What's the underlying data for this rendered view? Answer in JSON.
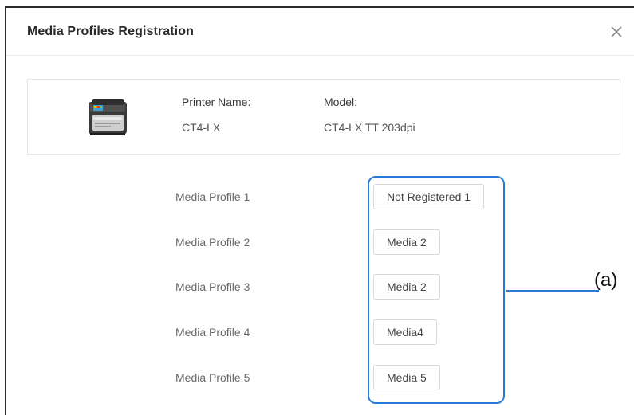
{
  "dialog": {
    "title": "Media Profiles Registration",
    "close_icon": "close-icon"
  },
  "printer": {
    "image_icon": "printer-icon",
    "name_label": "Printer Name:",
    "name_value": "CT4-LX",
    "model_label": "Model:",
    "model_value": "CT4-LX TT 203dpi"
  },
  "profiles": [
    {
      "label": "Media Profile 1",
      "value": "Not Registered 1"
    },
    {
      "label": "Media Profile 2",
      "value": "Media 2"
    },
    {
      "label": "Media Profile 3",
      "value": "Media 2"
    },
    {
      "label": "Media Profile 4",
      "value": "Media4"
    },
    {
      "label": "Media Profile 5",
      "value": "Media 5"
    }
  ],
  "callout": {
    "label": "(a)",
    "color": "#2a7bd6"
  }
}
